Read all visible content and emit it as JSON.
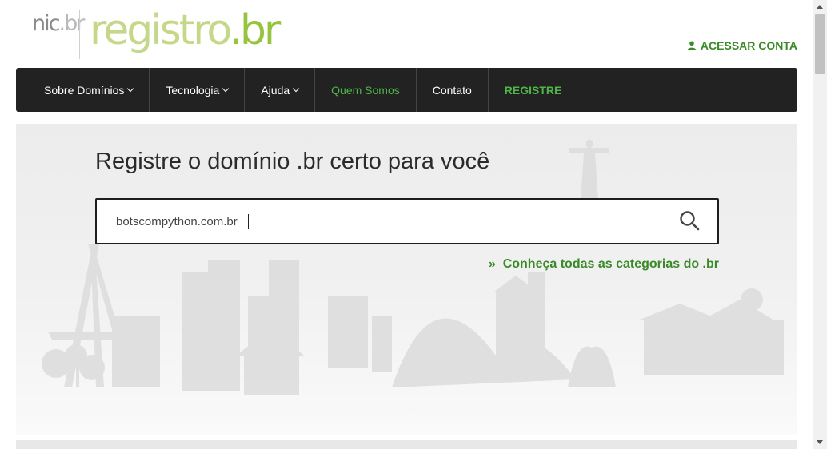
{
  "header": {
    "logo_nic": "nic",
    "logo_nic_dot": ".",
    "logo_nic_br": "br",
    "logo_registro": "registro",
    "logo_registro_dot": ".",
    "logo_registro_br": "br",
    "account_label": "ACESSAR CONTA",
    "account_icon": "user-icon"
  },
  "nav": {
    "items": [
      {
        "label": "Sobre Domínios"
      },
      {
        "label": "Tecnologia"
      },
      {
        "label": "Ajuda"
      },
      {
        "label": "Quem Somos"
      },
      {
        "label": "Contato"
      },
      {
        "label": "REGISTRE"
      }
    ]
  },
  "hero": {
    "title": "Registre o domínio .br certo para você",
    "search_value": "botscompython.com.br",
    "search_icon": "search-icon",
    "categories_arrow": "»",
    "categories_link": "Conheça todas as categorias do .br"
  },
  "colors": {
    "brand_green": "#3a8a28",
    "nav_bg": "#222222",
    "nav_highlight": "#4eb548",
    "logo_light_green": "#c5d88a",
    "logo_green": "#96c43c"
  }
}
